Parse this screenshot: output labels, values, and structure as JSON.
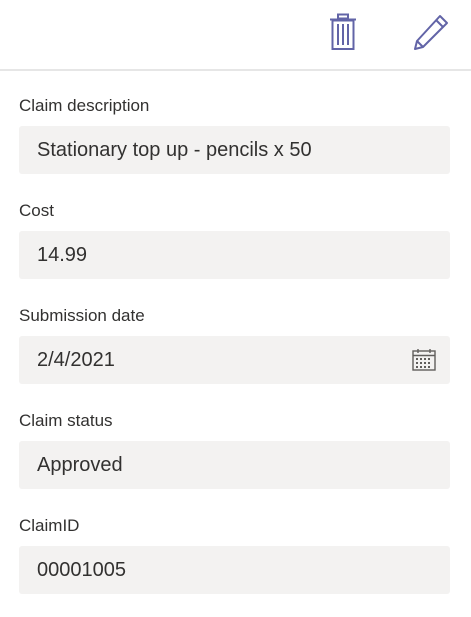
{
  "toolbar": {
    "delete_icon": "trash-icon",
    "edit_icon": "pencil-icon",
    "icon_color": "#6264a7"
  },
  "fields": [
    {
      "label": "Claim description",
      "value": "Stationary top up - pencils x 50"
    },
    {
      "label": "Cost",
      "value": "14.99"
    },
    {
      "label": "Submission date",
      "value": "2/4/2021",
      "icon": "calendar-icon"
    },
    {
      "label": "Claim status",
      "value": "Approved"
    },
    {
      "label": "ClaimID",
      "value": "00001005"
    }
  ],
  "colors": {
    "field_background": "#f3f2f1",
    "text": "#323130",
    "divider": "#e6e6e6"
  }
}
